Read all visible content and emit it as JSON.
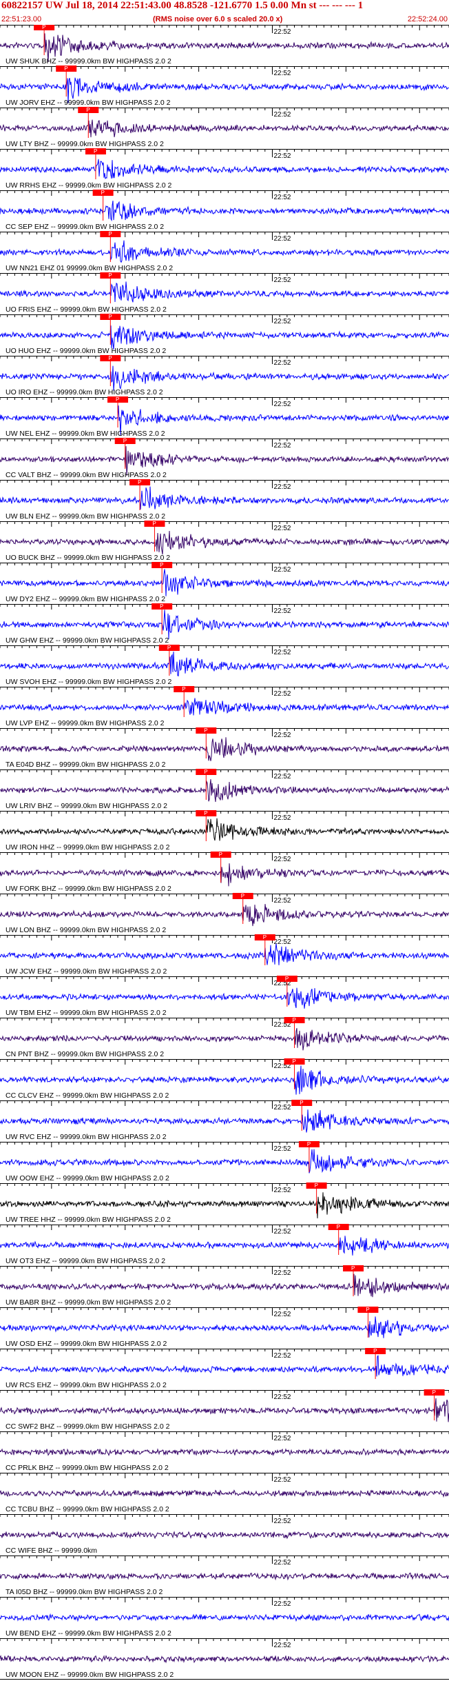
{
  "header": {
    "title": "60822157 UW Jul 18, 2014 22:51:43.00   48.8528 -121.6770  1.5 0.00 Mn st --- --- --- 1",
    "rms_note": "(RMS noise over 6.0 s scaled 20.0 x)",
    "start_time": "22:51:23.00",
    "end_time": "22:52:24.00"
  },
  "colors": {
    "trace_blue": "#0000ff",
    "trace_purple": "#330066",
    "trace_black": "#000000",
    "pick_red": "#ff0000",
    "label_text": "#000000"
  },
  "chart_data": {
    "type": "line",
    "title": "",
    "time_range": [
      "22:51:23.00",
      "22:52:24.00"
    ],
    "minute_tick_label": "22:52",
    "pick_label": "P",
    "traces": [
      {
        "label": "UW SHUK BHZ -- 99999.0km BW  HIGHPASS  2.0  2",
        "color": "purple",
        "pick": "22:51:29"
      },
      {
        "label": "UW JORV EHZ -- 99999.0km BW  HIGHPASS  2.0  2",
        "color": "blue",
        "pick": "22:51:32"
      },
      {
        "label": "UW LTY BHZ -- 99999.0km BW  HIGHPASS  2.0  2",
        "color": "purple",
        "pick": "22:51:35"
      },
      {
        "label": "UW RRHS EHZ -- 99999.0km BW  HIGHPASS  2.0  2",
        "color": "blue",
        "pick": "22:51:36"
      },
      {
        "label": "CC SEP EHZ -- 99999.0km BW  HIGHPASS  2.0  2",
        "color": "blue",
        "pick": "22:51:37"
      },
      {
        "label": "UW NN21 EHZ 01 99999.0km BW  HIGHPASS  2.0  2",
        "color": "blue",
        "pick": "22:51:38"
      },
      {
        "label": "UO FRIS EHZ -- 99999.0km BW  HIGHPASS  2.0  2",
        "color": "blue",
        "pick": "22:51:38"
      },
      {
        "label": "UO HUO EHZ -- 99999.0km BW  HIGHPASS  2.0  2",
        "color": "blue",
        "pick": "22:51:38"
      },
      {
        "label": "UO IRO EHZ -- 99999.0km BW  HIGHPASS  2.0  2",
        "color": "blue",
        "pick": "22:51:38"
      },
      {
        "label": "UW NEL EHZ -- 99999.0km BW  HIGHPASS  2.0  2",
        "color": "blue",
        "pick": "22:51:39"
      },
      {
        "label": "CC VALT BHZ -- 99999.0km BW  HIGHPASS  2.0  2",
        "color": "purple",
        "pick": "22:51:40"
      },
      {
        "label": "UW BLN EHZ -- 99999.0km BW  HIGHPASS  2.0  2",
        "color": "blue",
        "pick": "22:51:42"
      },
      {
        "label": "UO BUCK BHZ -- 99999.0km BW  HIGHPASS  2.0  2",
        "color": "purple",
        "pick": "22:51:44"
      },
      {
        "label": "UW DY2 EHZ -- 99999.0km BW  HIGHPASS  2.0  2",
        "color": "blue",
        "pick": "22:51:45"
      },
      {
        "label": "UW GHW EHZ -- 99999.0km BW  HIGHPASS  2.0  2",
        "color": "blue",
        "pick": "22:51:45"
      },
      {
        "label": "UW SVOH EHZ -- 99999.0km BW  HIGHPASS  2.0  2",
        "color": "blue",
        "pick": "22:51:46"
      },
      {
        "label": "UW LVP EHZ -- 99999.0km BW  HIGHPASS  2.0  2",
        "color": "blue",
        "pick": "22:51:48"
      },
      {
        "label": "TA E04D BHZ -- 99999.0km BW  HIGHPASS  2.0  2",
        "color": "purple",
        "pick": "22:51:51"
      },
      {
        "label": "UW LRIV BHZ -- 99999.0km BW  HIGHPASS  2.0  2",
        "color": "purple",
        "pick": "22:51:51"
      },
      {
        "label": "UW IRON HHZ -- 99999.0km BW  HIGHPASS  2.0  2",
        "color": "black",
        "pick": "22:51:51"
      },
      {
        "label": "UW FORK BHZ -- 99999.0km BW  HIGHPASS  2.0  2",
        "color": "purple",
        "pick": "22:51:53"
      },
      {
        "label": "UW LON BHZ -- 99999.0km BW  HIGHPASS  2.0  2",
        "color": "purple",
        "pick": "22:51:56"
      },
      {
        "label": "UW JCW EHZ -- 99999.0km BW  HIGHPASS  2.0  2",
        "color": "blue",
        "pick": "22:51:59"
      },
      {
        "label": "UW TBM EHZ -- 99999.0km BW  HIGHPASS  2.0  2",
        "color": "blue",
        "pick": "22:52:02"
      },
      {
        "label": "CN PNT BHZ -- 99999.0km BW  HIGHPASS  2.0  2",
        "color": "purple",
        "pick": "22:52:03"
      },
      {
        "label": "CC CLCV EHZ -- 99999.0km BW  HIGHPASS  2.0  2",
        "color": "blue",
        "pick": "22:52:03"
      },
      {
        "label": "UW RVC EHZ -- 99999.0km BW  HIGHPASS  2.0  2",
        "color": "blue",
        "pick": "22:52:04"
      },
      {
        "label": "UW OOW EHZ -- 99999.0km BW  HIGHPASS  2.0  2",
        "color": "blue",
        "pick": "22:52:05"
      },
      {
        "label": "UW TREE HHZ -- 99999.0km BW  HIGHPASS  2.0  2",
        "color": "black",
        "pick": "22:52:06"
      },
      {
        "label": "UW OT3 EHZ -- 99999.0km BW  HIGHPASS  2.0  2",
        "color": "blue",
        "pick": "22:52:09"
      },
      {
        "label": "UW BABR BHZ -- 99999.0km BW  HIGHPASS  2.0  2",
        "color": "purple",
        "pick": "22:52:11"
      },
      {
        "label": "UW OSD EHZ -- 99999.0km BW  HIGHPASS  2.0  2",
        "color": "blue",
        "pick": "22:52:13"
      },
      {
        "label": "UW RCS EHZ -- 99999.0km BW  HIGHPASS  2.0  2",
        "color": "blue",
        "pick": "22:52:14"
      },
      {
        "label": "CC SWF2 BHZ -- 99999.0km BW  HIGHPASS  2.0  2",
        "color": "purple",
        "pick": "22:52:22"
      },
      {
        "label": "CC PRLK BHZ -- 99999.0km BW  HIGHPASS  2.0  2",
        "color": "purple",
        "pick": ""
      },
      {
        "label": "CC TCBU BHZ -- 99999.0km BW  HIGHPASS  2.0  2",
        "color": "purple",
        "pick": ""
      },
      {
        "label": "CC WIFE BHZ -- 99999.0km",
        "color": "purple",
        "pick": ""
      },
      {
        "label": "TA I05D BHZ -- 99999.0km BW  HIGHPASS  2.0  2",
        "color": "purple",
        "pick": ""
      },
      {
        "label": "UW BEND EHZ -- 99999.0km BW  HIGHPASS  2.0  2",
        "color": "blue",
        "pick": ""
      },
      {
        "label": "UW MOON EHZ -- 99999.0km BW  HIGHPASS  2.0  2",
        "color": "purple",
        "pick": ""
      }
    ]
  }
}
